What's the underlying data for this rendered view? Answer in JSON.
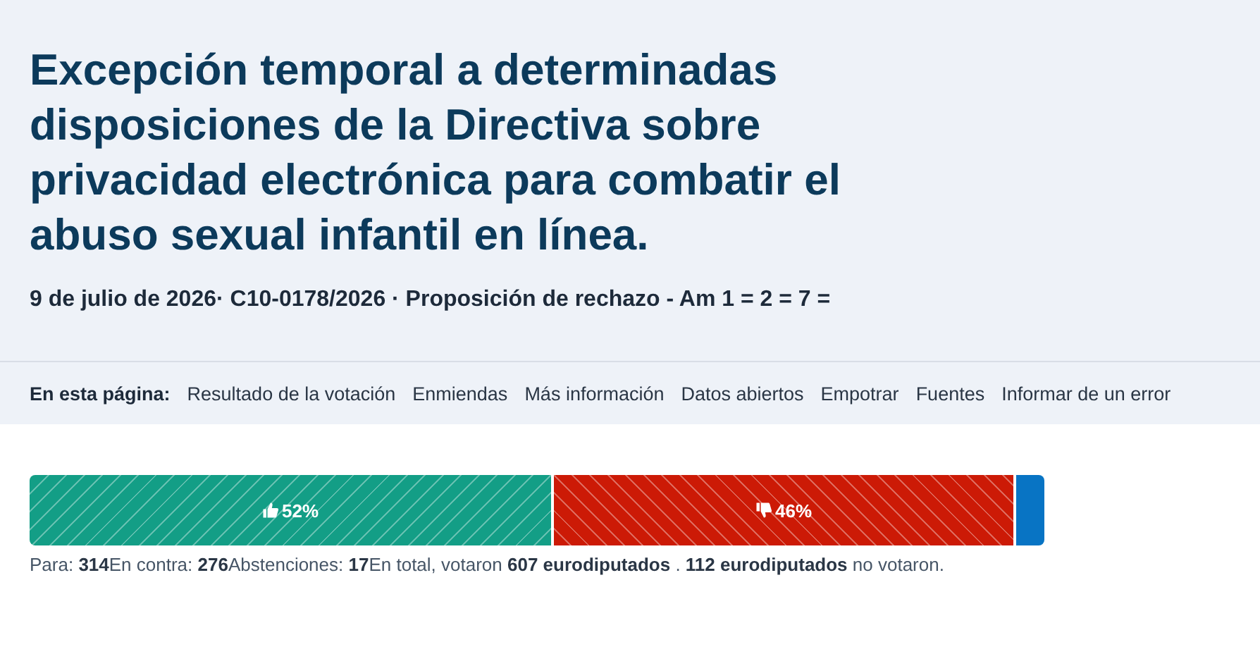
{
  "title": "Excepción temporal a determinadas disposiciones de la Directiva sobre privacidad electrónica para combatir el abuso sexual infantil en línea.",
  "subtitle": "9 de julio de 2026· C10-0178/2026 · Proposición de rechazo - Am 1 = 2 = 7 =",
  "nav": {
    "label": "En esta página:",
    "links": [
      "Resultado de la votación",
      "Enmiendas",
      "Más información",
      "Datos abiertos",
      "Empotrar",
      "Fuentes",
      "Informar de un error"
    ]
  },
  "result_bar": [
    {
      "kind": "for",
      "label": "52%"
    },
    {
      "kind": "against",
      "label": "46%"
    },
    {
      "kind": "abstain"
    }
  ],
  "summary": [
    "Para: **314**",
    "En contra: **276**",
    "Abstenciones: **17**",
    "En total, votaron **607 eurodiputados** . **112 eurodiputados** no votaron."
  ]
}
